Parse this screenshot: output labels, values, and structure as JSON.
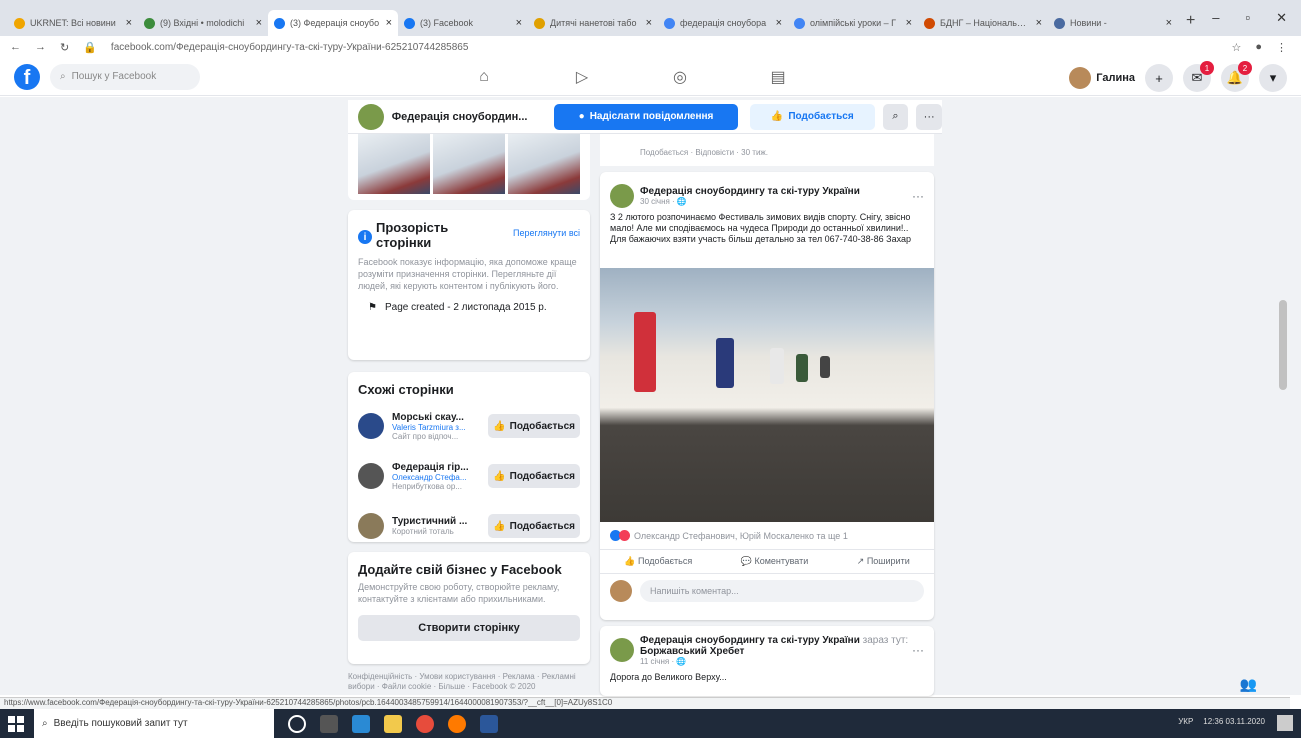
{
  "browser": {
    "tabs": [
      {
        "label": "UKRNET: Всі новини",
        "color": "#f0a500"
      },
      {
        "label": "(9) Вхідні • molodichi",
        "color": "#3c8c3c"
      },
      {
        "label": "(3) Федерація сноубо",
        "color": "#1877f2",
        "active": true
      },
      {
        "label": "(3) Facebook",
        "color": "#1877f2"
      },
      {
        "label": "Дитячі нанетові табо",
        "color": "#e0a000"
      },
      {
        "label": "федерація сноубора",
        "color": "#4285f4"
      },
      {
        "label": "олімпійські уроки – Г",
        "color": "#4285f4"
      },
      {
        "label": "БДНГ – Національний",
        "color": "#d04a02"
      },
      {
        "label": "Новини -",
        "color": "#4a6aa0"
      }
    ],
    "url": "facebook.com/Федерація-сноубордингу-та-скі-туру-України-625210744285865"
  },
  "fb": {
    "search_placeholder": "Пошук у Facebook",
    "user_name": "Галина",
    "messenger_badge": "1",
    "notif_badge": "2"
  },
  "page": {
    "name": "Федерація сноубордин...",
    "send_message": "Надіслати повідомлення",
    "like": "Подобається",
    "prev_tail_actions": "Подобається · Відповісти · 30 тиж."
  },
  "transparency": {
    "title": "Прозорість сторінки",
    "see_all": "Переглянути всі",
    "desc": "Facebook показує інформацію, яка допоможе краще розуміти призначення сторінки. Перегляньте дії людей, які керують контентом і публікують його.",
    "created": "Page created - 2 листопада 2015 р."
  },
  "similar": {
    "title": "Схожі сторінки",
    "items": [
      {
        "name": "Морські скау...",
        "sub": "Valeris Tarzmiura з...",
        "desc": "Сайт про відпоч...",
        "color": "#2a4a8a",
        "btn": "Подобається"
      },
      {
        "name": "Федерація гір...",
        "sub": "Олександр Стефа...",
        "desc": "Неприбуткова ор...",
        "color": "#555555",
        "btn": "Подобається"
      },
      {
        "name": "Туристичний ...",
        "sub": "",
        "desc": "Коротний тоталь",
        "color": "#8a7a5a",
        "btn": "Подобається"
      }
    ]
  },
  "business": {
    "title": "Додайте свій бізнес у Facebook",
    "desc": "Демонструйте свою роботу, створюйте рекламу, контактуйте з клієнтами або прихильниками.",
    "button": "Створити сторінку"
  },
  "footer": "Конфіденційність · Умови користування · Реклама · Рекламні вибори · Файли cookie · Більше · Facebook © 2020",
  "post": {
    "author": "Федерація сноубордингу та скі-туру України",
    "time": "30 січня · 🌐",
    "text": "З 2 лютого розпочинаємо Фестиваль зимових видів спорту. Снігу, звісно мало! Але ми сподіваємось на чудеса Природи до останньої хвилини!.. Для бажаючих взяти участь більш детально за тел 067-740-38-86 Захар",
    "reactions": "Олександр Стефанович, Юрій Москаленко та ще 1",
    "act_like": "Подобається",
    "act_comment": "Коментувати",
    "act_share": "Поширити",
    "comment_placeholder": "Напишіть коментар..."
  },
  "post2": {
    "author": "Федерація сноубордингу та скі-туру України",
    "suffix": "зараз тут:",
    "place": "Боржавський Хребет",
    "time": "11 січня · 🌐",
    "text": "Дорога до Великого Верху..."
  },
  "status_url": "https://www.facebook.com/Федерація-сноубордингу-та-скі-туру-України-625210744285865/photos/pcb.1644003485759914/1644000081907353/?__cft__[0]=AZUy8S1C0",
  "taskbar": {
    "search_placeholder": "Введіть пошуковий запит тут",
    "tray": "УКР",
    "time": "12:36",
    "date": "03.11.2020"
  }
}
